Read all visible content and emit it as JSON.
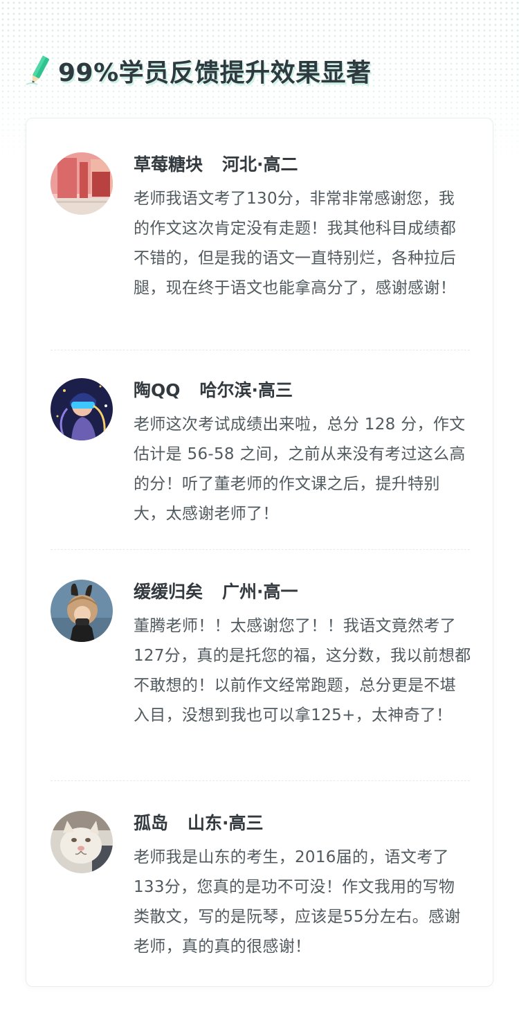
{
  "header": {
    "title": "99%学员反馈提升效果显著",
    "icon": "pencil-icon"
  },
  "colors": {
    "accent": "#2fc38f",
    "title": "#2f3a40",
    "text": "#505a5f",
    "name": "#333a3f",
    "divider": "#e6eaec"
  },
  "reviews": [
    {
      "name": "草莓糖块",
      "location": "河北·高二",
      "text": "老师我语文考了130分，非常非常感谢您，我的作文这次肯定没有走题！我其他科目成绩都不错的，但是我的语文一直特别烂，各种拉后腿，现在终于语文也能拿高分了，感谢感谢！",
      "avatar": "pink-wall-avatar"
    },
    {
      "name": "陶QQ",
      "location": "哈尔滨·高三",
      "text": "老师这次考试成绩出来啦，总分 128 分，作文估计是 56-58 之间，之前从来没有考过这么高的分！听了董老师的作文课之后，提升特别大，太感谢老师了！",
      "avatar": "vr-girl-avatar"
    },
    {
      "name": "缓缓归矣",
      "location": "广州·高一",
      "text": "董腾老师！！太感谢您了！！我语文竟然考了127分，真的是托您的福，这分数，我以前想都不敢想的！以前作文经常跑题，总分更是不堪入目，没想到我也可以拿125+，太神奇了！",
      "avatar": "bunny-ears-avatar"
    },
    {
      "name": "孤岛",
      "location": "山东·高三",
      "text": "老师我是山东的考生，2016届的，语文考了133分，您真的是功不可没！作文我用的写物类散文，写的是阮琴，应该是55分左右。感谢老师，真的真的很感谢！",
      "avatar": "cat-avatar"
    }
  ]
}
